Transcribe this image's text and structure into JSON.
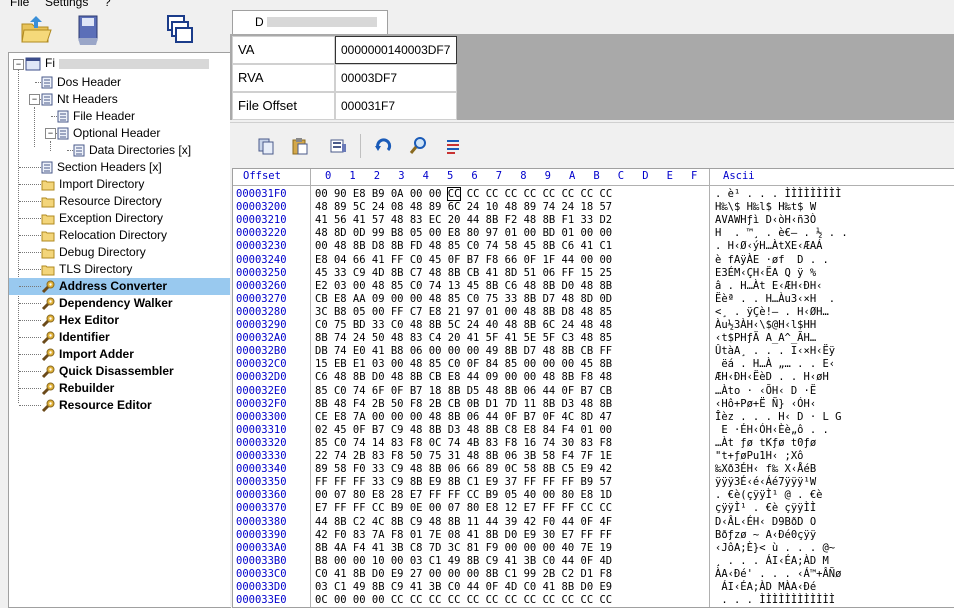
{
  "menu": {
    "file": "File",
    "settings": "Settings",
    "help": "?"
  },
  "tab": {
    "label": "D"
  },
  "address": {
    "rows": [
      {
        "label": "VA",
        "value": "0000000140003DF7"
      },
      {
        "label": "RVA",
        "value": "00003DF7"
      },
      {
        "label": "File Offset",
        "value": "000031F7"
      }
    ]
  },
  "tree": {
    "root_label": "Fi",
    "items": [
      {
        "label": "Dos Header"
      },
      {
        "label": "Nt Headers"
      },
      {
        "label": "File Header"
      },
      {
        "label": "Optional Header"
      },
      {
        "label": "Data Directories [x]"
      },
      {
        "label": "Section Headers [x]"
      },
      {
        "label": "Import Directory"
      },
      {
        "label": "Resource Directory"
      },
      {
        "label": "Exception Directory"
      },
      {
        "label": "Relocation Directory"
      },
      {
        "label": "Debug Directory"
      },
      {
        "label": "TLS Directory"
      },
      {
        "label": "Address Converter"
      },
      {
        "label": "Dependency Walker"
      },
      {
        "label": "Hex Editor"
      },
      {
        "label": "Identifier"
      },
      {
        "label": "Import Adder"
      },
      {
        "label": "Quick Disassembler"
      },
      {
        "label": "Rebuilder"
      },
      {
        "label": "Resource Editor"
      }
    ]
  },
  "hex": {
    "header": {
      "offset": "Offset",
      "cols": [
        "0",
        "1",
        "2",
        "3",
        "4",
        "5",
        "6",
        "7",
        "8",
        "9",
        "A",
        "B",
        "C",
        "D",
        "E",
        "F"
      ],
      "ascii": "Ascii"
    },
    "rows": [
      {
        "off": "000031F0",
        "bytes": "00 90 E8 B9 0A 00 00 CC CC CC CC CC CC CC CC CC",
        "asc": ". è¹ . . . ÌÌÌÌÌÌÌÌÌ"
      },
      {
        "off": "00003200",
        "bytes": "48 89 5C 24 08 48 89 6C 24 10 48 89 74 24 18 57",
        "asc": "H‰\\$ H‰l$ H‰t$ W"
      },
      {
        "off": "00003210",
        "bytes": "41 56 41 57 48 83 EC 20 44 8B F2 48 8B F1 33 D2",
        "asc": "AVAWHƒì D‹òH‹ñ3Ò"
      },
      {
        "off": "00003220",
        "bytes": "48 8D 0D 99 B8 05 00 E8 80 97 01 00 BD 01 00 00",
        "asc": "H  . ™¸ . è€— . ½ . ."
      },
      {
        "off": "00003230",
        "bytes": "00 48 8B D8 8B FD 48 85 C0 74 58 45 8B C6 41 C1",
        "asc": ". H‹Ø‹ýH…ÀtXE‹ÆAÁ"
      },
      {
        "off": "00003240",
        "bytes": "E8 04 66 41 FF C0 45 0F B7 F8 66 0F 1F 44 00 00",
        "asc": "è fAÿÀE ·øf  D . ."
      },
      {
        "off": "00003250",
        "bytes": "45 33 C9 4D 8B C7 48 8B CB 41 8D 51 06 FF 15 25",
        "asc": "E3ÉM‹ÇH‹ËA Q ÿ %"
      },
      {
        "off": "00003260",
        "bytes": "E2 03 00 48 85 C0 74 13 45 8B C6 48 8B D0 48 8B",
        "asc": "â . H…Àt E‹ÆH‹ÐH‹"
      },
      {
        "off": "00003270",
        "bytes": "CB E8 AA 09 00 00 48 85 C0 75 33 8B D7 48 8D 0D",
        "asc": "Ëèª . . H…Àu3‹×H  ."
      },
      {
        "off": "00003280",
        "bytes": "3C B8 05 00 FF C7 E8 21 97 01 00 48 8B D8 48 85",
        "asc": "<¸ . ÿÇè!— . H‹ØH…"
      },
      {
        "off": "00003290",
        "bytes": "C0 75 BD 33 C0 48 8B 5C 24 40 48 8B 6C 24 48 48",
        "asc": "Àu½3ÀH‹\\$@H‹l$HH"
      },
      {
        "off": "000032A0",
        "bytes": "8B 74 24 50 48 83 C4 20 41 5F 41 5E 5F C3 48 85",
        "asc": "‹t$PHƒÄ A_A^_ÃH…"
      },
      {
        "off": "000032B0",
        "bytes": "DB 74 E0 41 B8 06 00 00 00 49 8B D7 48 8B CB FF",
        "asc": "ÛtàA¸ . . . I‹×H‹Ëÿ"
      },
      {
        "off": "000032C0",
        "bytes": "15 EB E1 03 00 48 85 C0 0F 84 85 00 00 00 45 8B",
        "asc": " ëá . H…À „… . . E‹"
      },
      {
        "off": "000032D0",
        "bytes": "C6 48 8B D0 48 8B CB E8 44 09 00 00 48 8B F8 48",
        "asc": "ÆH‹ÐH‹ËèD . . H‹øH"
      },
      {
        "off": "000032E0",
        "bytes": "85 C0 74 6F 0F B7 18 8B D5 48 8B 06 44 0F B7 CB",
        "asc": "…Àto · ‹ÕH‹ D ·Ë"
      },
      {
        "off": "000032F0",
        "bytes": "8B 48 F4 2B 50 F8 2B CB 0B D1 7D 11 8B D3 48 8B",
        "asc": "‹Hô+Pø+Ë Ñ} ‹ÓH‹"
      },
      {
        "off": "00003300",
        "bytes": "CE E8 7A 00 00 00 48 8B 06 44 0F B7 0F 4C 8D 47",
        "asc": "Îèz . . . H‹ D · L G"
      },
      {
        "off": "00003310",
        "bytes": "02 45 0F B7 C9 48 8B D3 48 8B C8 E8 84 F4 01 00",
        "asc": " E ·ÉH‹ÓH‹Èè„ô . ."
      },
      {
        "off": "00003320",
        "bytes": "85 C0 74 14 83 F8 0C 74 4B 83 F8 16 74 30 83 F8",
        "asc": "…Àt ƒø tKƒø t0ƒø"
      },
      {
        "off": "00003330",
        "bytes": "22 74 2B 83 F8 50 75 31 48 8B 06 3B 58 F4 7F 1E",
        "asc": "\"t+ƒøPu1H‹ ;Xô  "
      },
      {
        "off": "00003340",
        "bytes": "89 58 F0 33 C9 48 8B 06 66 89 0C 58 8B C5 E9 42",
        "asc": "‰Xð3ÉH‹ f‰ X‹ÅéB"
      },
      {
        "off": "00003350",
        "bytes": "FF FF FF 33 C9 8B E9 8B C1 E9 37 FF FF FF B9 57",
        "asc": "ÿÿÿ3É‹é‹Áé7ÿÿÿ¹W"
      },
      {
        "off": "00003360",
        "bytes": "00 07 80 E8 28 E7 FF FF CC B9 05 40 00 80 E8 1D",
        "asc": ". €è(çÿÿÌ¹ @ . €è "
      },
      {
        "off": "00003370",
        "bytes": "E7 FF FF CC B9 0E 00 07 80 E8 12 E7 FF FF CC CC",
        "asc": "çÿÿÌ¹ . €è çÿÿÌÌ"
      },
      {
        "off": "00003380",
        "bytes": "44 8B C2 4C 8B C9 48 8B 11 44 39 42 F0 44 0F 4F",
        "asc": "D‹ÂL‹ÉH‹ D9BðD O"
      },
      {
        "off": "00003390",
        "bytes": "42 F0 83 7A F8 01 7E 08 41 8B D0 E9 30 E7 FF FF",
        "asc": "Bðƒzø ~ A‹Ðé0çÿÿ"
      },
      {
        "off": "000033A0",
        "bytes": "8B 4A F4 41 3B C8 7D 3C 81 F9 00 00 00 40 7E 19",
        "asc": "‹JôA;È}< ù . . . @~ "
      },
      {
        "off": "000033B0",
        "bytes": "B8 00 00 10 00 03 C1 49 8B C9 41 3B C0 44 0F 4D",
        "asc": "¸ . . . ÁI‹ÉA;ÀD M"
      },
      {
        "off": "000033C0",
        "bytes": "C0 41 8B D0 E9 27 00 00 00 8B C1 99 2B C2 D1 F8",
        "asc": "ÀA‹Ðé' . . . ‹Á™+ÂÑø"
      },
      {
        "off": "000033D0",
        "bytes": "03 C1 49 8B C9 41 3B C0 44 0F 4D C0 41 8B D0 E9",
        "asc": " ÁI‹ÉA;ÀD MÀA‹Ðé"
      },
      {
        "off": "000033E0",
        "bytes": "0C 00 00 00 CC CC CC CC CC CC CC CC CC CC CC CC",
        "asc": " . . . ÌÌÌÌÌÌÌÌÌÌÌÌ"
      }
    ]
  }
}
